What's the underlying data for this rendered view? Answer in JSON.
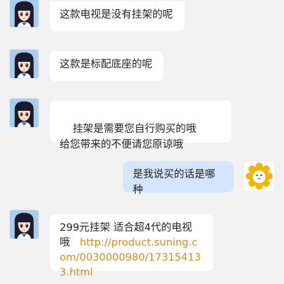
{
  "messages": [
    {
      "side": "left",
      "text": "这款电视是没有挂架的呢"
    },
    {
      "side": "left",
      "text": "这款是标配底座的呢"
    },
    {
      "side": "left",
      "text": "挂架是需要您自行购买的哦     给您带来的不便请您原谅哦"
    },
    {
      "side": "right",
      "text": "是我说买的话是哪种"
    },
    {
      "side": "left",
      "text_line1": "299元挂架 适合超4代的电视",
      "text_line2_prefix": "哦",
      "link": "http://product.suning.com/0030000980/173154133.html"
    }
  ],
  "colors": {
    "background": "#f2f2f2",
    "left_bubble": "#ffffff",
    "right_bubble": "#d3e6fb",
    "link": "#d98a1a"
  },
  "icons": {
    "agent_avatar": "anime-girl-avatar-icon",
    "user_avatar": "lion-avatar-icon"
  }
}
